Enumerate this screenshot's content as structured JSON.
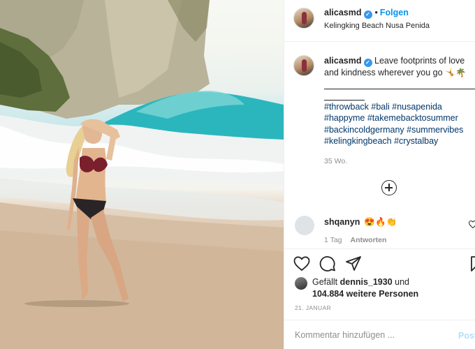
{
  "post": {
    "username": "alicasmd",
    "verified_icon": "verified-badge-icon",
    "follow_label": "Folgen",
    "location": "Kelingking Beach Nusa Penida",
    "caption": "Leave footprints of love and kindness wherever you go",
    "caption_emoji": "🤸🌴",
    "hashtags": [
      "#throwback #bali #nusapenida",
      "#happyme #takemebacktosummer",
      "#backincoldgermany #summervibes",
      "#kelingkingbeach #crystalbay"
    ],
    "time_ago": "35 Wo."
  },
  "comments": [
    {
      "username": "shqanyn",
      "text": "😍🔥👏",
      "time": "1 Tag",
      "reply_label": "Antworten"
    }
  ],
  "likes": {
    "prefix": "Gefällt",
    "user": "dennis_1930",
    "conjunction": "und",
    "others": "104.884 weitere Personen"
  },
  "date": "21. JANUAR",
  "comment_box": {
    "placeholder": "Kommentar hinzufügen ...",
    "post_label": "Posten"
  },
  "colors": {
    "link_blue": "#0095f6",
    "hashtag": "#00376b",
    "muted": "#8e8e8e"
  }
}
